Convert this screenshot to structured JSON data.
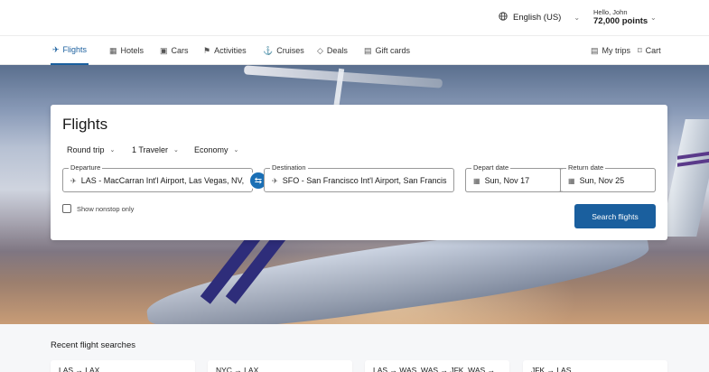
{
  "header": {
    "language": "English (US)",
    "greeting": "Hello, John",
    "points": "72,000 points"
  },
  "nav": {
    "items": [
      {
        "label": "Flights",
        "icon": "plane-icon"
      },
      {
        "label": "Hotels",
        "icon": "hotel-icon"
      },
      {
        "label": "Cars",
        "icon": "car-icon"
      },
      {
        "label": "Activities",
        "icon": "flag-icon"
      },
      {
        "label": "Cruises",
        "icon": "ship-icon"
      },
      {
        "label": "Deals",
        "icon": "tag-icon"
      },
      {
        "label": "Gift cards",
        "icon": "gift-card-icon"
      }
    ],
    "my_trips": "My trips",
    "cart": "Cart"
  },
  "search": {
    "title": "Flights",
    "trip_type": "Round trip",
    "travelers": "1 Traveler",
    "cabin": "Economy",
    "departure_label": "Departure",
    "departure_value": "LAS - MacCarran Int'l Airport, Las Vegas, NV,",
    "destination_label": "Destination",
    "destination_value": "SFO - San Francisco Int'l Airport, San Francis",
    "depart_date_label": "Depart date",
    "depart_date_value": "Sun, Nov 17",
    "return_date_label": "Return date",
    "return_date_value": "Sun, Nov 25",
    "nonstop_label": "Show nonstop only",
    "nonstop_checked": false,
    "submit_label": "Search flights"
  },
  "recent": {
    "title": "Recent flight searches",
    "items": [
      {
        "label": "LAS → LAX"
      },
      {
        "label": "NYC → LAX"
      },
      {
        "label": "LAS → WAS, WAS → JFK, WAS →"
      },
      {
        "label": "JFK → LAS"
      }
    ]
  },
  "colors": {
    "accent": "#1a5f9e",
    "swap_button": "#1a6fb5"
  }
}
